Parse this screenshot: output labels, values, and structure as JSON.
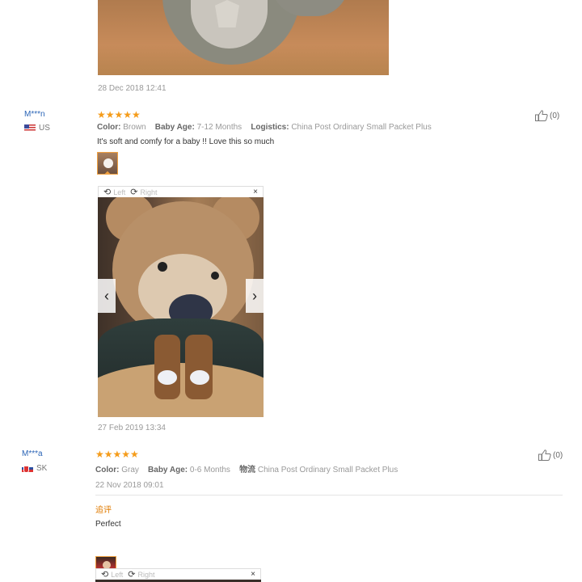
{
  "reviews": [
    {
      "date": "28 Dec 2018 12:41"
    },
    {
      "user": "M***n",
      "country": "US",
      "stars": "★★★★★",
      "color_label": "Color:",
      "color_value": "Brown",
      "age_label": "Baby Age:",
      "age_value": "7-12 Months",
      "logistics_label": "Logistics:",
      "logistics_value": "China Post Ordinary Small Packet Plus",
      "text": "It's soft and comfy for a baby !! Love this so much",
      "likes": "(0)",
      "viewer_left": "Left",
      "viewer_right": "Right",
      "close": "×",
      "date": "27 Feb 2019 13:34"
    },
    {
      "user": "M***a",
      "country": "SK",
      "stars": "★★★★★",
      "color_label": "Color:",
      "color_value": "Gray",
      "age_label": "Baby Age:",
      "age_value": "0-6 Months",
      "logistics_label": "物流",
      "logistics_value": "China Post Ordinary Small Packet Plus",
      "date": "22 Nov 2018 09:01",
      "likes": "(0)",
      "followup_label": "追评",
      "followup_text": "Perfect",
      "viewer_left": "Left",
      "viewer_right": "Right",
      "close": "×"
    }
  ],
  "icons": [
    "thumbs-up-icon",
    "rotate-left-icon",
    "rotate-right-icon",
    "close-icon",
    "chevron-left-icon",
    "chevron-right-icon"
  ],
  "colors": {
    "star": "#f59c1a",
    "username": "#2a64b6",
    "followup": "#e07b00",
    "thumb_border": "#f0a040"
  }
}
